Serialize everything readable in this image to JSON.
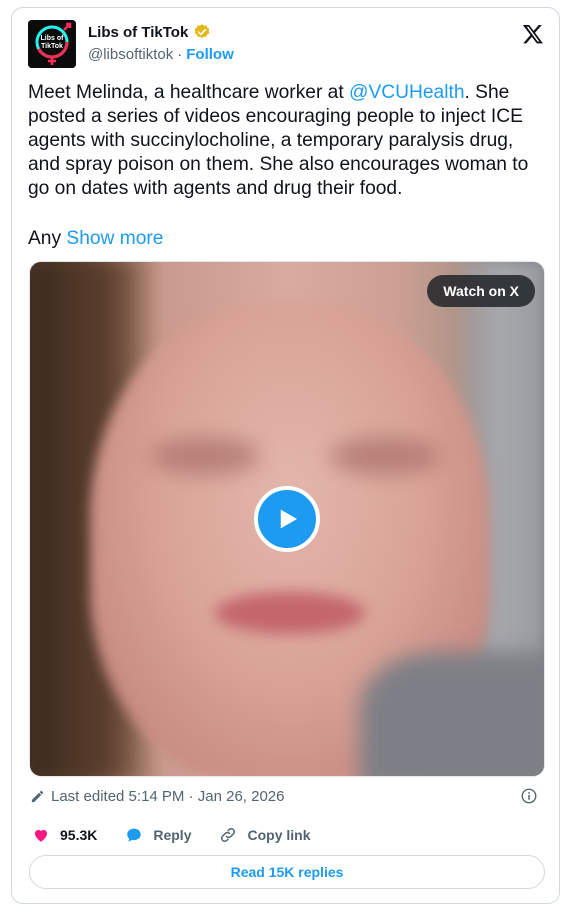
{
  "author": {
    "display_name": "Libs of TikTok",
    "handle": "@libsoftiktok",
    "separator": "·",
    "follow_label": "Follow",
    "avatar_text_1": "Libs of",
    "avatar_text_2": "TikTok",
    "verified_color": "#e2b719"
  },
  "tweet": {
    "text_part1": "Meet Melinda, a healthcare worker at ",
    "mention": "@VCUHealth",
    "text_part2": ". She posted a series of videos encouraging people to inject ICE agents with succinylocholine, a temporary paralysis drug, and spray poison on them. She also encourages woman to go on dates with agents and drug their food.",
    "truncated_text": "Any",
    "show_more_label": "Show more"
  },
  "media": {
    "watch_label": "Watch on X",
    "play_icon": "play-icon"
  },
  "meta": {
    "edited_label": "Last edited 5:14 PM · Jan 26, 2026"
  },
  "actions": {
    "likes": "95.3K",
    "reply_label": "Reply",
    "copy_link_label": "Copy link",
    "read_replies_label": "Read 15K replies"
  },
  "colors": {
    "accent": "#1d9bf0",
    "like": "#f91880",
    "text": "#0f1419",
    "muted": "#536471"
  }
}
